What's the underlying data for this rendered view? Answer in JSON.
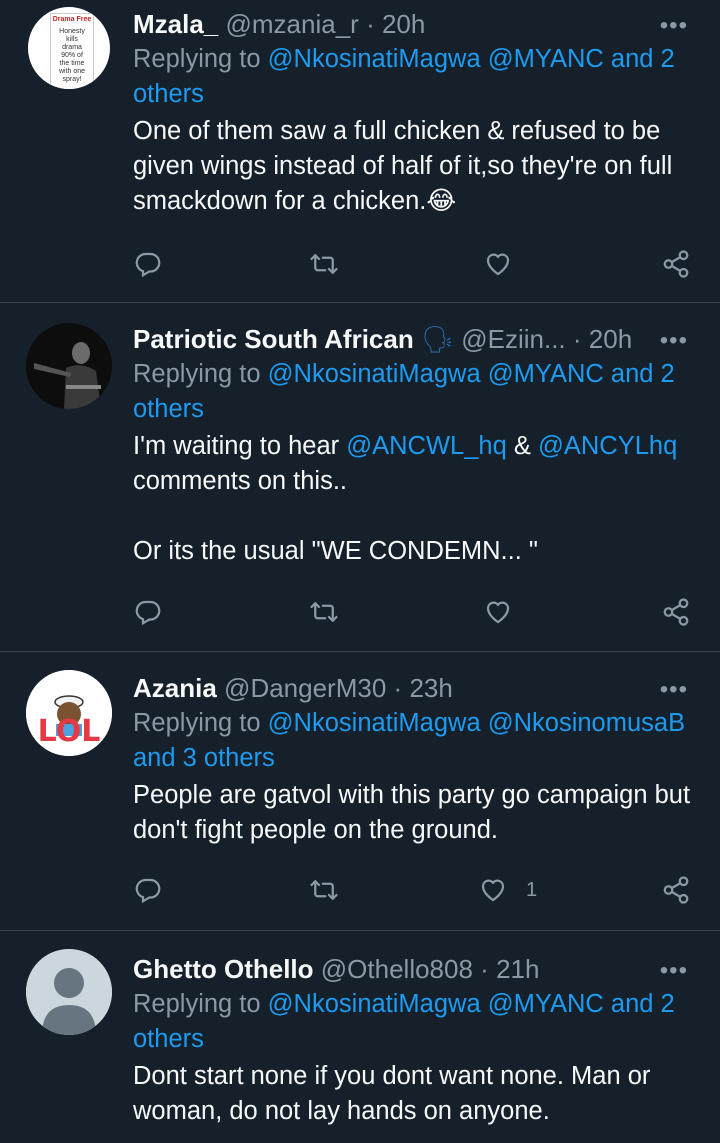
{
  "tweets": [
    {
      "name": "Mzala_",
      "handle": "@mzania_r",
      "dot": "·",
      "time": "20h",
      "replying_prefix": "Replying to",
      "replying_mentions": "@NkosinatiMagwa @MYANC and 2 others",
      "body": "One of them saw a full chicken & refused to be given wings instead of half of it,so they're on full smackdown for a chicken.😂",
      "avatar_text": [
        "Drama Free",
        "Honesty",
        "kills",
        "drama",
        "90% of",
        "the time",
        "with one",
        "spray!"
      ],
      "like_count": ""
    },
    {
      "name": "Patriotic South African",
      "name_emoji": "🗣",
      "handle": "@Eziin...",
      "dot": "·",
      "time": "20h",
      "replying_prefix": "Replying to",
      "replying_mentions": "@NkosinatiMagwa @MYANC and 2 others",
      "body_line1_prefix": "I'm waiting to hear",
      "body_line1_m1": "@ANCWL_hq",
      "body_line1_amp": "&",
      "body_line1_m2": "@ANCYLhq",
      "body_line2": "comments on this..",
      "body_line3": "Or its the usual \"WE CONDEMN... \"",
      "like_count": ""
    },
    {
      "name": "Azania",
      "handle": "@DangerM30",
      "dot": "·",
      "time": "23h",
      "replying_prefix": "Replying to",
      "replying_mentions": "@NkosinatiMagwa @NkosinomusaB and 3 others",
      "body": "People are gatvol with this party go campaign but don't fight people on the ground.",
      "avatar_text": [
        "LOL"
      ],
      "like_count": "1"
    },
    {
      "name": "Ghetto Othello",
      "handle": "@Othello808",
      "dot": "·",
      "time": "21h",
      "replying_prefix": "Replying to",
      "replying_mentions": "@NkosinatiMagwa @MYANC and 2 others",
      "body": "Dont start none if you dont want none. Man or woman, do not lay hands on anyone.",
      "like_count": ""
    }
  ],
  "ui": {
    "more_glyph": "•••"
  },
  "colors": {
    "background": "#15202b",
    "divider": "#38444d",
    "primary_text": "#f7f9f9",
    "secondary_text": "#8b98a5",
    "link": "#1d9bf0"
  },
  "icons": [
    "reply-icon",
    "retweet-icon",
    "like-icon",
    "share-icon",
    "more-icon"
  ]
}
